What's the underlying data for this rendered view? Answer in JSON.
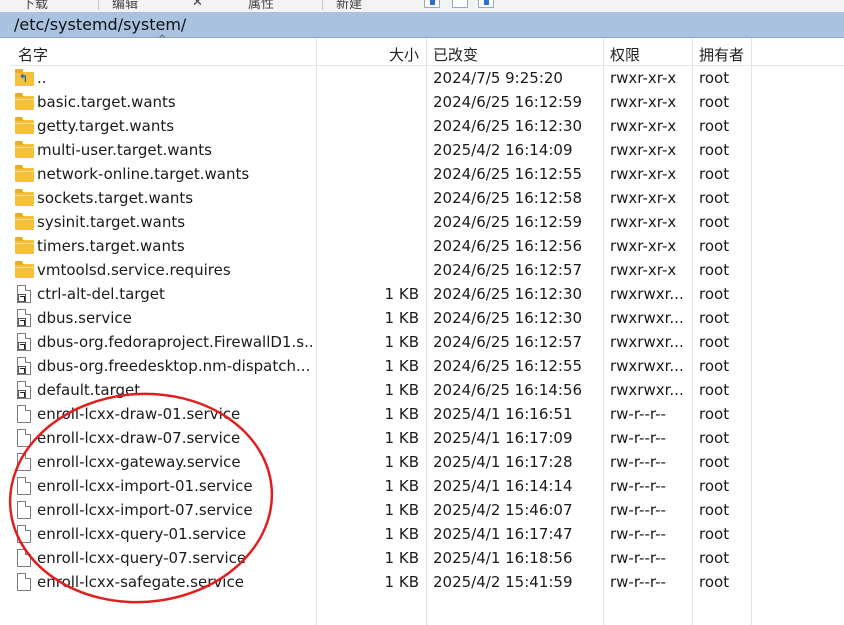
{
  "toolbar": {
    "items": [
      "下载",
      "编辑",
      "✕",
      "属性",
      "新建"
    ],
    "accent": "#2f6fd0"
  },
  "path": "/etc/systemd/system/",
  "columns": {
    "name": "名字",
    "size": "大小",
    "modified": "已改变",
    "permissions": "权限",
    "owner": "拥有者"
  },
  "rows": [
    {
      "name": "..",
      "size": "",
      "modified": "2024/7/5 9:25:20",
      "perm": "rwxr-xr-x",
      "owner": "root",
      "icon": "parent-folder-icon"
    },
    {
      "name": "basic.target.wants",
      "size": "",
      "modified": "2024/6/25 16:12:59",
      "perm": "rwxr-xr-x",
      "owner": "root",
      "icon": "folder-icon"
    },
    {
      "name": "getty.target.wants",
      "size": "",
      "modified": "2024/6/25 16:12:30",
      "perm": "rwxr-xr-x",
      "owner": "root",
      "icon": "folder-icon"
    },
    {
      "name": "multi-user.target.wants",
      "size": "",
      "modified": "2025/4/2 16:14:09",
      "perm": "rwxr-xr-x",
      "owner": "root",
      "icon": "folder-icon"
    },
    {
      "name": "network-online.target.wants",
      "size": "",
      "modified": "2024/6/25 16:12:55",
      "perm": "rwxr-xr-x",
      "owner": "root",
      "icon": "folder-icon"
    },
    {
      "name": "sockets.target.wants",
      "size": "",
      "modified": "2024/6/25 16:12:58",
      "perm": "rwxr-xr-x",
      "owner": "root",
      "icon": "folder-icon"
    },
    {
      "name": "sysinit.target.wants",
      "size": "",
      "modified": "2024/6/25 16:12:59",
      "perm": "rwxr-xr-x",
      "owner": "root",
      "icon": "folder-icon"
    },
    {
      "name": "timers.target.wants",
      "size": "",
      "modified": "2024/6/25 16:12:56",
      "perm": "rwxr-xr-x",
      "owner": "root",
      "icon": "folder-icon"
    },
    {
      "name": "vmtoolsd.service.requires",
      "size": "",
      "modified": "2024/6/25 16:12:57",
      "perm": "rwxr-xr-x",
      "owner": "root",
      "icon": "folder-icon"
    },
    {
      "name": "ctrl-alt-del.target",
      "size": "1 KB",
      "modified": "2024/6/25 16:12:30",
      "perm": "rwxrwxr...",
      "owner": "root",
      "icon": "symlink-file-icon"
    },
    {
      "name": "dbus.service",
      "size": "1 KB",
      "modified": "2024/6/25 16:12:30",
      "perm": "rwxrwxr...",
      "owner": "root",
      "icon": "symlink-file-icon"
    },
    {
      "name": "dbus-org.fedoraproject.FirewallD1.s...",
      "size": "1 KB",
      "modified": "2024/6/25 16:12:57",
      "perm": "rwxrwxr...",
      "owner": "root",
      "icon": "symlink-file-icon"
    },
    {
      "name": "dbus-org.freedesktop.nm-dispatch...",
      "size": "1 KB",
      "modified": "2024/6/25 16:12:55",
      "perm": "rwxrwxr...",
      "owner": "root",
      "icon": "symlink-file-icon"
    },
    {
      "name": "default.target",
      "size": "1 KB",
      "modified": "2024/6/25 16:14:56",
      "perm": "rwxrwxr...",
      "owner": "root",
      "icon": "symlink-file-icon"
    },
    {
      "name": "enroll-lcxx-draw-01.service",
      "size": "1 KB",
      "modified": "2025/4/1 16:16:51",
      "perm": "rw-r--r--",
      "owner": "root",
      "icon": "file-icon"
    },
    {
      "name": "enroll-lcxx-draw-07.service",
      "size": "1 KB",
      "modified": "2025/4/1 16:17:09",
      "perm": "rw-r--r--",
      "owner": "root",
      "icon": "file-icon"
    },
    {
      "name": "enroll-lcxx-gateway.service",
      "size": "1 KB",
      "modified": "2025/4/1 16:17:28",
      "perm": "rw-r--r--",
      "owner": "root",
      "icon": "file-icon"
    },
    {
      "name": "enroll-lcxx-import-01.service",
      "size": "1 KB",
      "modified": "2025/4/1 16:14:14",
      "perm": "rw-r--r--",
      "owner": "root",
      "icon": "file-icon"
    },
    {
      "name": "enroll-lcxx-import-07.service",
      "size": "1 KB",
      "modified": "2025/4/2 15:46:07",
      "perm": "rw-r--r--",
      "owner": "root",
      "icon": "file-icon"
    },
    {
      "name": "enroll-lcxx-query-01.service",
      "size": "1 KB",
      "modified": "2025/4/1 16:17:47",
      "perm": "rw-r--r--",
      "owner": "root",
      "icon": "file-icon"
    },
    {
      "name": "enroll-lcxx-query-07.service",
      "size": "1 KB",
      "modified": "2025/4/1 16:18:56",
      "perm": "rw-r--r--",
      "owner": "root",
      "icon": "file-icon"
    },
    {
      "name": "enroll-lcxx-safegate.service",
      "size": "1 KB",
      "modified": "2025/4/2 15:41:59",
      "perm": "rw-r--r--",
      "owner": "root",
      "icon": "file-icon"
    }
  ],
  "annotation": {
    "color": "#e02020"
  }
}
